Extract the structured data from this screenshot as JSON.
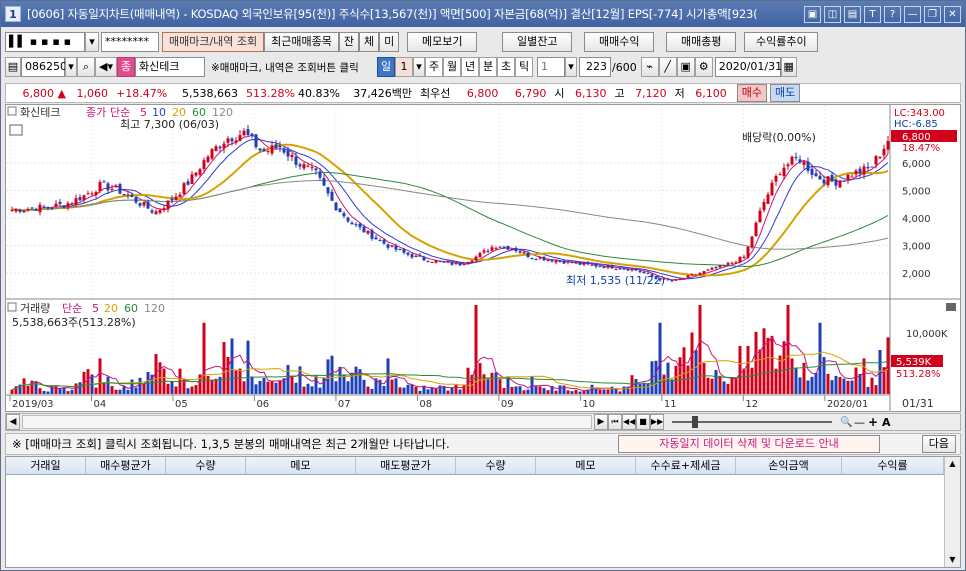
{
  "titlebar": {
    "icon": "1",
    "title": "[0606] 자동일지차트(매매내역) - KOSDAQ 외국인보유[95(천)] 주식수[13,567(천)] 액면[500] 자본금[68(억)] 결산[12월] EPS[-774] 시가총액[923(",
    "buttons": [
      "▣",
      "◫",
      "▤",
      "T",
      "?",
      "—",
      "❐",
      "✕"
    ]
  },
  "toolbar1": {
    "account": "▌▌ ▪ ▪ ▪ ▪",
    "password": "********",
    "btn_trade_query": "매매마크/내역 조회",
    "btn_recent": "최근매매종목",
    "btn_jan": "잔",
    "btn_che": "체",
    "btn_mi": "미",
    "btn_memo": "메모보기",
    "btn_daily_balance": "일별잔고",
    "btn_trade_profit": "매매수익",
    "btn_trade_total": "매매총평",
    "btn_return_trend": "수익률추이"
  },
  "toolbar2": {
    "stock_code": "086250",
    "stock_badge": "종",
    "stock_name": "화신테크",
    "hint": "※매매마크, 내역은 조회버튼 클릭",
    "period_sel": "일",
    "period_num": "1",
    "periods": [
      "주",
      "월",
      "년",
      "분",
      "초",
      "틱"
    ],
    "tick_num": "1",
    "count": "223",
    "count_total": "/600",
    "date": "2020/01/31"
  },
  "quote": {
    "price": "6,800 ▲",
    "change": "1,060",
    "change_pct": "+18.47%",
    "volume": "5,538,663",
    "vol_ratio": "513.28%",
    "pct2": "40.83%",
    "amount": "37,426백만",
    "best_label": "최우선",
    "ask": "6,800",
    "bid": "6,790",
    "open_label": "시",
    "open": "6,130",
    "high_label": "고",
    "high": "7,120",
    "low_label": "저",
    "low": "6,100",
    "buy_btn": "매수",
    "sell_btn": "매도"
  },
  "chart_texts": {
    "stock_label": "화신테크",
    "legend_close": "종가",
    "legend_ma": "단순",
    "ma_periods": [
      "5",
      "10",
      "20",
      "60",
      "120"
    ],
    "high_ann": "최고 7,300 (06/03)",
    "low_ann": "최저 1,535 (11/22)",
    "div_ann": "배당락(0.00%)",
    "lc": "LC:343.00",
    "hc": "HC:-6.85",
    "cur_price": "6,800",
    "cur_pct": "18.47%",
    "vol_label": "거래량",
    "vol_ma_label": "단순",
    "vol_ma_periods": [
      "5",
      "20",
      "60",
      "120"
    ],
    "vol_value": "5,538,663주(513.28%)",
    "vol_tag": "5,539K",
    "vol_tag_pct": "513.28%",
    "vol_axis": "10,000K",
    "date_end": "01/31"
  },
  "chart_data": {
    "type": "candlestick",
    "price_axis_ticks": [
      "6,000",
      "5,000",
      "4,000",
      "3,000",
      "2,000"
    ],
    "x_ticks": [
      "2019/03",
      "04",
      "05",
      "06",
      "07",
      "08",
      "09",
      "10",
      "11",
      "12",
      "2020/01"
    ],
    "close_path": [
      4300,
      4350,
      4400,
      4500,
      4800,
      5200,
      5000,
      4600,
      4200,
      4700,
      5400,
      6300,
      6900,
      7100,
      6400,
      6600,
      6000,
      5600,
      4500,
      3800,
      3400,
      3000,
      2700,
      2500,
      2400,
      2300,
      2600,
      3000,
      2900,
      2600,
      2500,
      2400,
      2300,
      2250,
      2200,
      2100,
      1800,
      1700,
      1900,
      2100,
      2300,
      2600,
      4500,
      5800,
      6200,
      5500,
      5300,
      5600,
      5800,
      6800
    ],
    "volume_rel": [
      1,
      2,
      1,
      1,
      3,
      2,
      1,
      2,
      5,
      3,
      2,
      4,
      6,
      3,
      2,
      4,
      3,
      2,
      5,
      3,
      2,
      2,
      1,
      1,
      1,
      1,
      5,
      3,
      2,
      1,
      1,
      1,
      1,
      1,
      1,
      2,
      4,
      6,
      10,
      4,
      3,
      5,
      9,
      7,
      5,
      4,
      3,
      3,
      2,
      7
    ]
  },
  "bottombar": {
    "ctrl": [
      "◀",
      "▶",
      "⏮",
      "◀◀",
      "■",
      "▶▶"
    ],
    "zoom": [
      "🔍",
      "—",
      "+",
      "A"
    ]
  },
  "notice": {
    "text": "※ [매매마크 조회] 클릭시 조회됩니다. 1,3,5 분봉의 매매내역은 최근 2개월만 나타납니다.",
    "link": "자동일지 데이터 삭제 및 다운로드 안내",
    "next": "다음"
  },
  "table": {
    "columns": [
      "거래일",
      "매수평균가",
      "수량",
      "메모",
      "매도평균가",
      "수량",
      "메모",
      "수수료+제세금",
      "손익금액",
      "수익률"
    ]
  }
}
